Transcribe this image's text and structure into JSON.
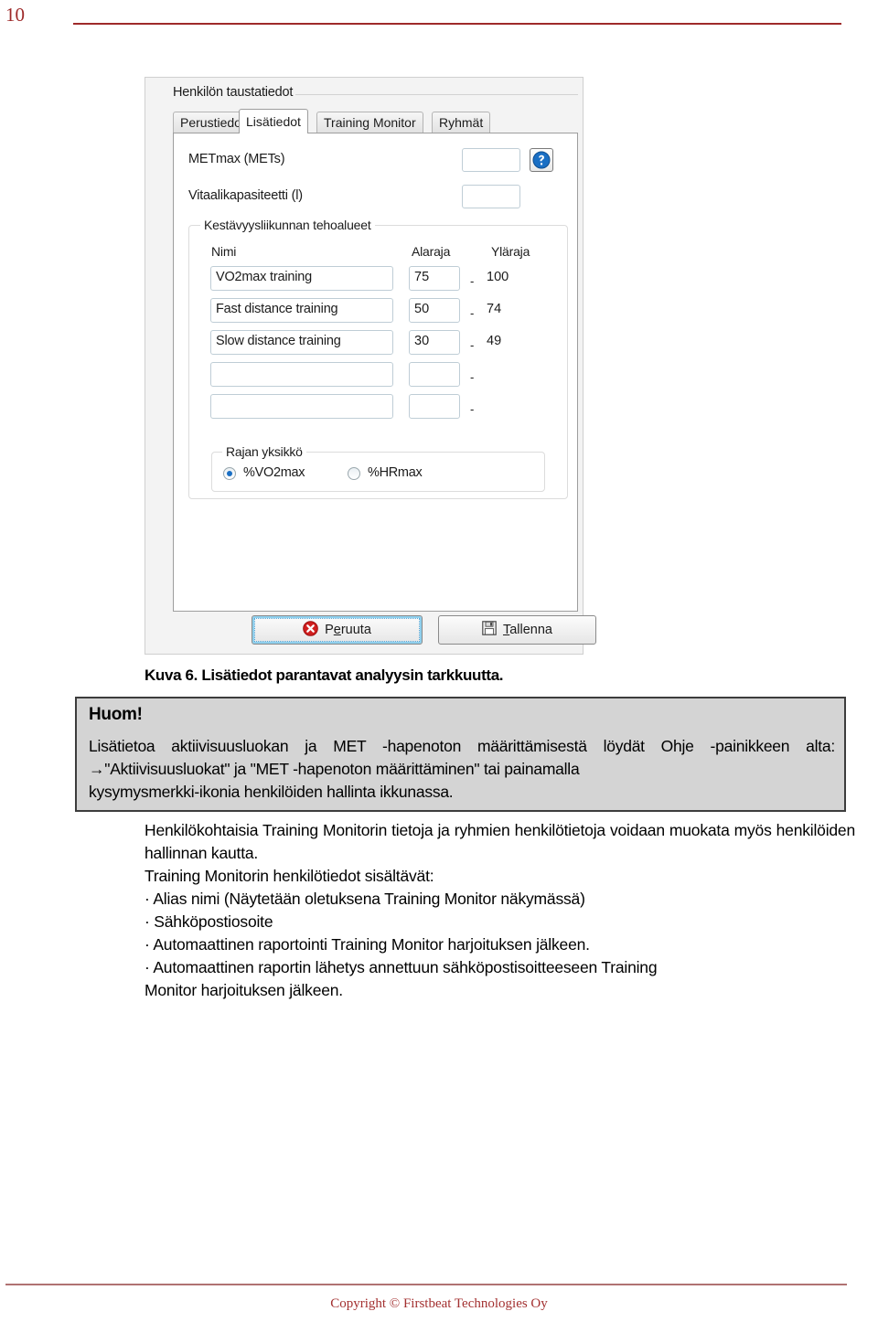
{
  "page": {
    "number": "10",
    "footer": "Copyright © Firstbeat Technologies Oy",
    "accent_color": "#9e2a2a",
    "footer_rule_color": "#b07272"
  },
  "screenshot": {
    "group_title": "Henkilön taustatiedot",
    "tabs": [
      {
        "label": "Perustiedot",
        "active": false
      },
      {
        "label": "Lisätiedot",
        "active": true
      },
      {
        "label": "Training Monitor",
        "active": false
      },
      {
        "label": "Ryhmät",
        "active": false
      }
    ],
    "fields": {
      "metmax_label": "METmax (METs)",
      "metmax_value": "",
      "vital_label": "Vitaalikapasiteetti (l)",
      "vital_value": "",
      "help_icon": "question-mark-icon"
    },
    "zones": {
      "legend": "Kestävyysliikunnan tehoalueet",
      "headers": {
        "name": "Nimi",
        "lower": "Alaraja",
        "upper": "Yläraja"
      },
      "separator": "-",
      "rows": [
        {
          "name": "VO2max training",
          "lower": "75",
          "upper": "100"
        },
        {
          "name": "Fast distance training",
          "lower": "50",
          "upper": "74"
        },
        {
          "name": "Slow distance training",
          "lower": "30",
          "upper": "49"
        },
        {
          "name": "",
          "lower": "",
          "upper": ""
        },
        {
          "name": "",
          "lower": "",
          "upper": ""
        }
      ]
    },
    "unit": {
      "legend": "Rajan yksikkö",
      "options": [
        {
          "label": "%VO2max",
          "selected": true
        },
        {
          "label": "%HRmax",
          "selected": false
        }
      ]
    },
    "buttons": {
      "cancel": {
        "before": "P",
        "accel": "e",
        "after": "ruuta",
        "icon": "cancel-x-icon"
      },
      "save": {
        "before": "",
        "accel": "T",
        "after": "allenna",
        "icon": "floppy-disk-save-icon"
      }
    }
  },
  "figure_caption": "Kuva 6. Lisätiedot parantavat analyysin tarkkuutta.",
  "note": {
    "title": "Huom!",
    "body": "Lisätietoa aktiivisuusluokan ja MET -hapenoton määrittämisestä löydät Ohje -painikkeen alta: →\"Aktiivisuusluokat\" ja \"MET -hapenoton määrittäminen\" tai painamalla ",
    "body_last": "kysymysmerkki-ikonia henkilöiden hallinta ikkunassa."
  },
  "body": {
    "paragraph_1": "Henkilökohtaisia Training Monitorin tietoja ja ryhmien henkilötietoja voidaan muokata myös henkilöiden hallinnan kautta.",
    "paragraph_2": "Training Monitorin henkilötiedot sisältävät:",
    "bullet_1": "· Alias nimi (Näytetään oletuksena Training Monitor näkymässä)",
    "bullet_2": "· Sähköpostiosoite",
    "bullet_3": "· Automaattinen raportointi Training Monitor harjoituksen jälkeen.",
    "bullet_4": "· Automaattinen raportin lähetys annettuun sähköpostisoitteeseen Training ",
    "bullet_4_tail": "Monitor harjoituksen jälkeen."
  }
}
